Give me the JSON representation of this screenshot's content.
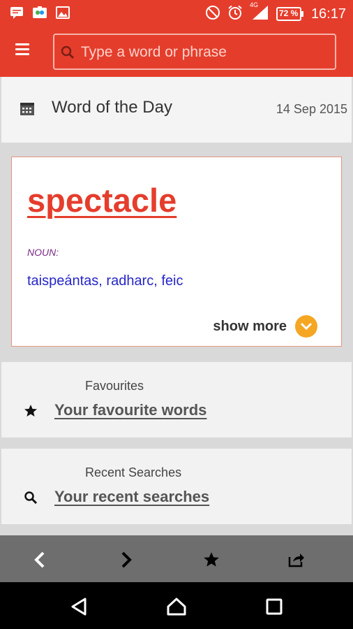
{
  "status_bar": {
    "time": "16:17",
    "battery": "72 %",
    "network": "4G",
    "icons": [
      "message-icon",
      "photos-icon",
      "gallery-icon",
      "do-not-disturb-icon",
      "alarm-icon",
      "signal-icon",
      "battery-icon"
    ]
  },
  "app_bar": {
    "search_placeholder": "Type a word or phrase",
    "icons": [
      "menu-icon",
      "search-icon"
    ]
  },
  "word_of_day": {
    "title": "Word of the Day",
    "date": "14 Sep 2015",
    "word": "spectacle",
    "part_of_speech": "NOUN:",
    "translation": "taispeántas, radharc, feic",
    "show_more": "show more"
  },
  "favourites": {
    "label": "Favourites",
    "link": "Your favourite words"
  },
  "recent": {
    "label": "Recent Searches",
    "link": "Your recent searches"
  },
  "toolbar": {
    "icons": [
      "back-arrow-icon",
      "forward-arrow-icon",
      "star-icon",
      "share-icon"
    ]
  },
  "nav_bar": {
    "icons": [
      "nav-back-icon",
      "nav-home-icon",
      "nav-recents-icon"
    ]
  },
  "colors": {
    "brand_red": "#e53d2c",
    "accent_orange": "#f5a623",
    "translation_blue": "#2626c8",
    "pos_purple": "#7a2a86"
  }
}
